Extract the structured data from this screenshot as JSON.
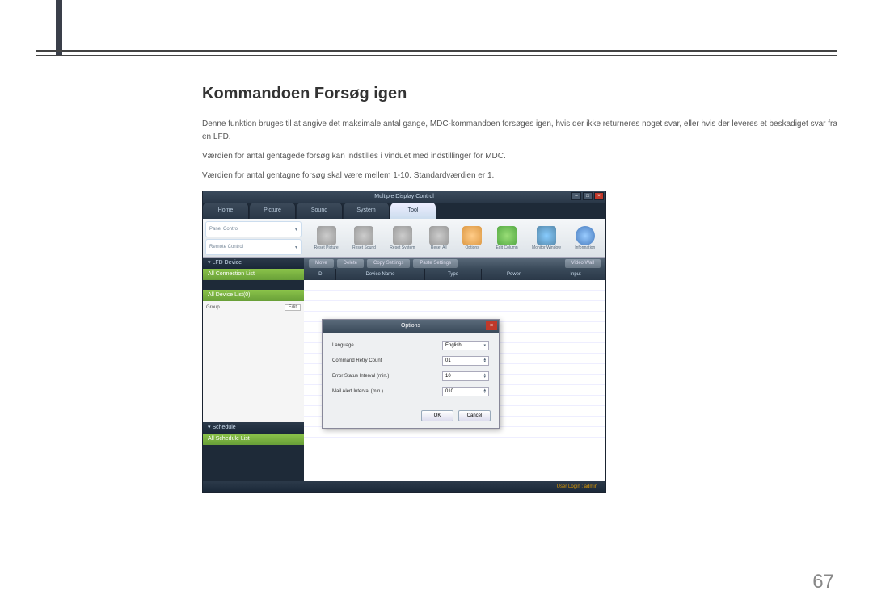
{
  "page_number": "67",
  "heading": "Kommandoen Forsøg igen",
  "paragraphs": [
    "Denne funktion bruges til at angive det maksimale antal gange, MDC-kommandoen forsøges igen, hvis der ikke returneres noget svar, eller hvis der leveres et beskadiget svar fra en LFD.",
    "Værdien for antal gentagede forsøg kan indstilles i vinduet med indstillinger for MDC.",
    "Værdien for antal gentagne forsøg skal være mellem 1-10. Standardværdien er 1."
  ],
  "app": {
    "title": "Multiple Display Control",
    "tabs": [
      "Home",
      "Picture",
      "Sound",
      "System",
      "Tool"
    ],
    "active_tab": "Tool",
    "ribbon_left": [
      "Panel Control",
      "Remote Control"
    ],
    "ribbon_icons": [
      {
        "label": "Reset Picture"
      },
      {
        "label": "Reset Sound"
      },
      {
        "label": "Reset System"
      },
      {
        "label": "Reset All"
      },
      {
        "label": "Options"
      },
      {
        "label": "Edit Column"
      },
      {
        "label": "Monitor Window"
      },
      {
        "label": "Information"
      }
    ],
    "sidebar": {
      "lfd_header": "▾ LFD Device",
      "all_conn": "All Connection List",
      "all_dev": "All Device List(0)",
      "group": "Group",
      "edit": "Edit",
      "schedule_header": "▾ Schedule",
      "all_sched": "All Schedule List"
    },
    "actions": [
      "Move",
      "Delete",
      "Copy Settings",
      "Paste Settings"
    ],
    "action_right": "Video Wall",
    "columns": [
      "ID",
      "Device Name",
      "Type",
      "Power",
      "Input"
    ],
    "status": "User Login : admin"
  },
  "dialog": {
    "title": "Options",
    "rows": [
      {
        "label": "Language",
        "value": "English",
        "type": "select"
      },
      {
        "label": "Command Retry Count",
        "value": "01",
        "type": "spin"
      },
      {
        "label": "Error Status Interval (min.)",
        "value": "10",
        "type": "spin"
      },
      {
        "label": "Mail Alert Interval (min.)",
        "value": "010",
        "type": "spin"
      }
    ],
    "ok": "OK",
    "cancel": "Cancel"
  }
}
